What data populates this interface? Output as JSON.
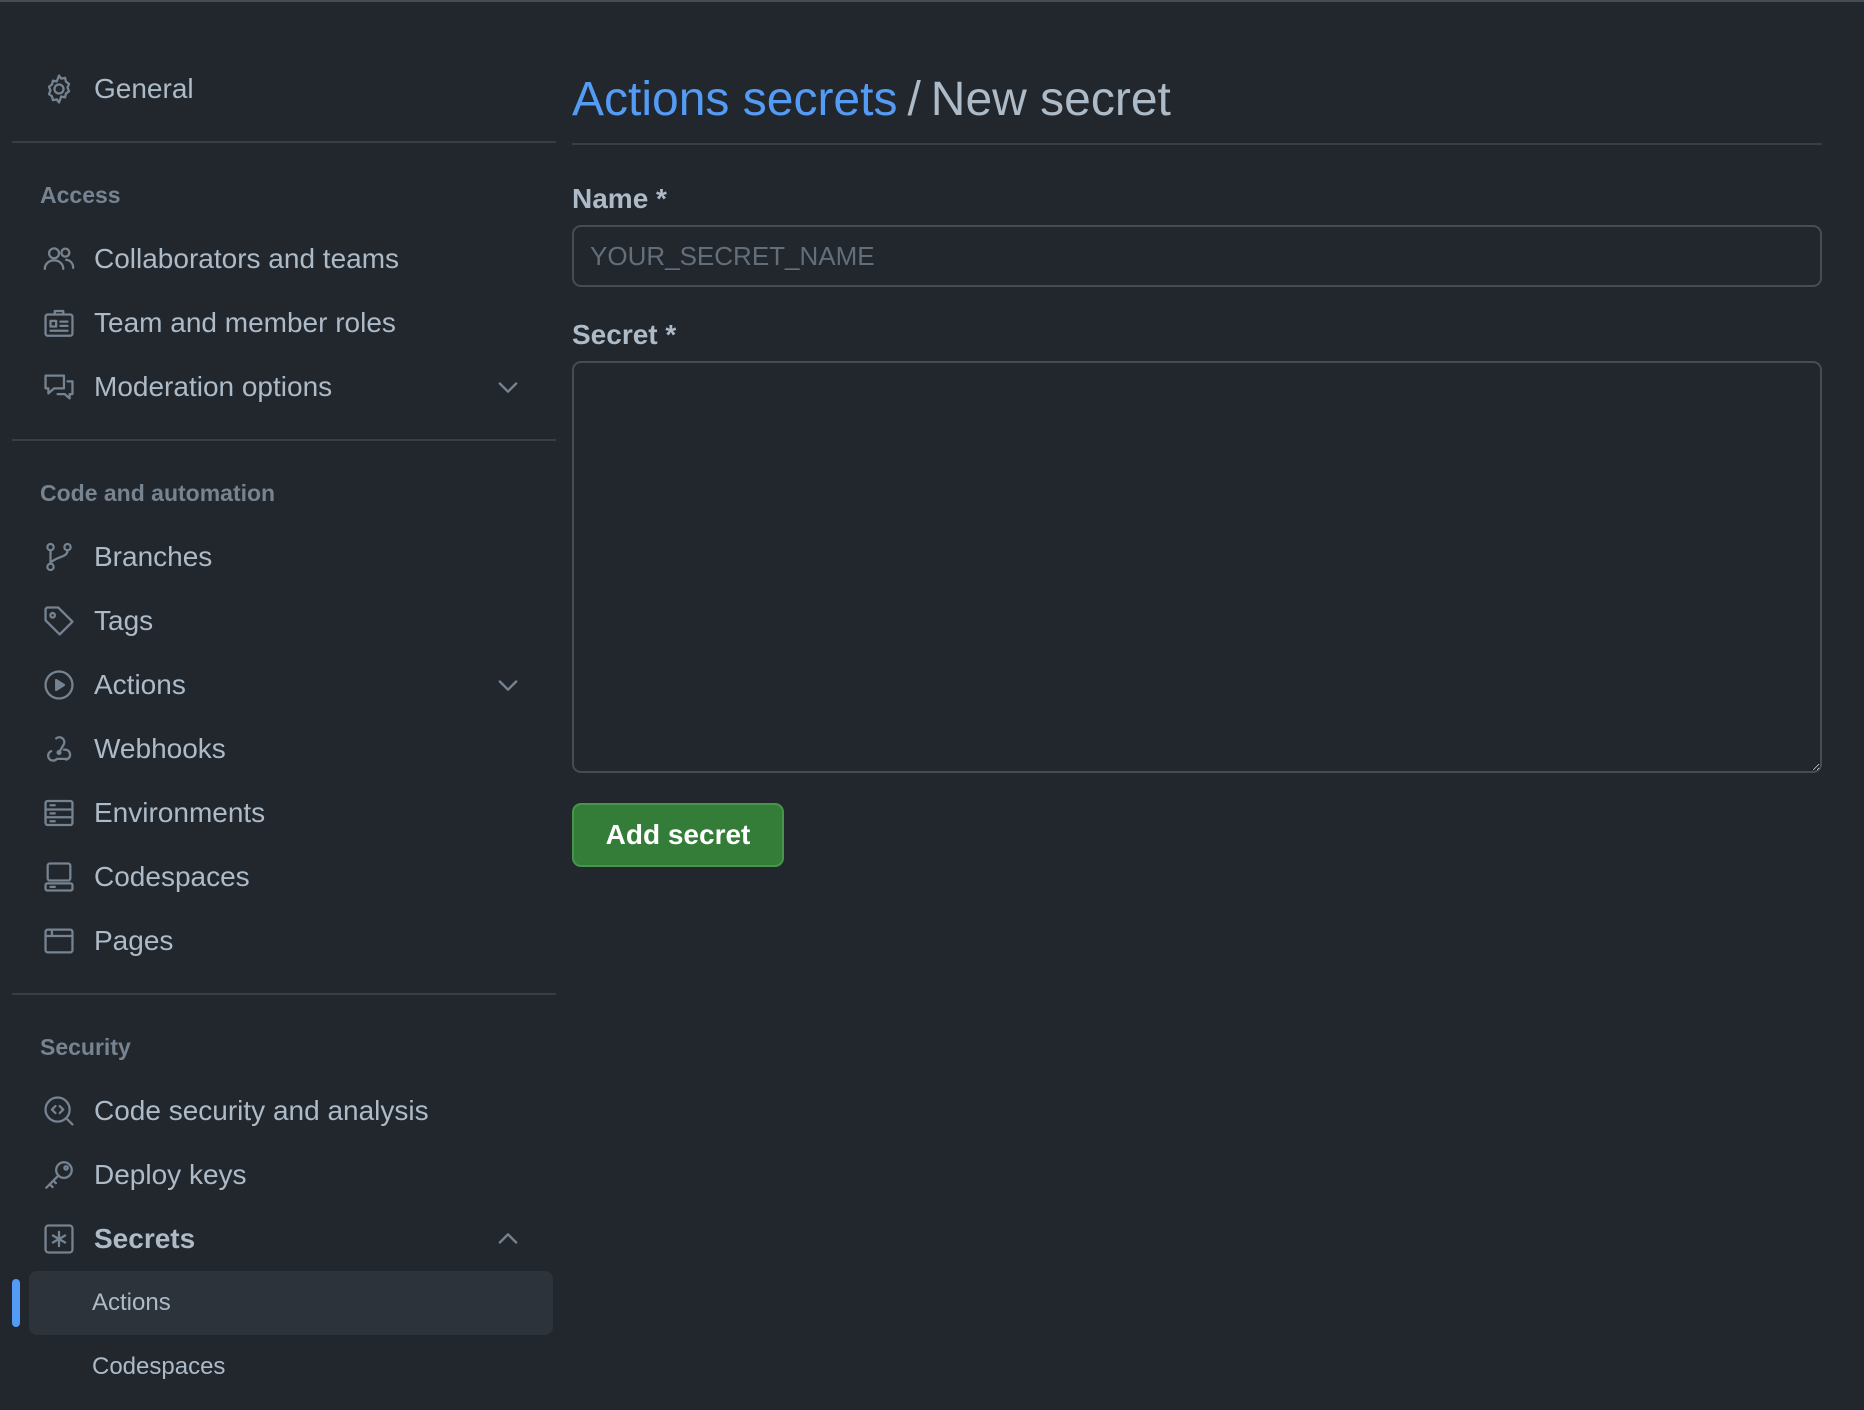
{
  "sidebar": {
    "general": {
      "label": "General",
      "icon": "gear-icon"
    },
    "sections": {
      "access": {
        "heading": "Access",
        "items": [
          {
            "label": "Collaborators and teams",
            "icon": "people-icon"
          },
          {
            "label": "Team and member roles",
            "icon": "id-badge-icon"
          },
          {
            "label": "Moderation options",
            "icon": "comment-discussion-icon",
            "expandable": true,
            "expanded": false
          }
        ]
      },
      "code_automation": {
        "heading": "Code and automation",
        "items": [
          {
            "label": "Branches",
            "icon": "git-branch-icon"
          },
          {
            "label": "Tags",
            "icon": "tag-icon"
          },
          {
            "label": "Actions",
            "icon": "play-icon",
            "expandable": true,
            "expanded": false
          },
          {
            "label": "Webhooks",
            "icon": "webhook-icon"
          },
          {
            "label": "Environments",
            "icon": "server-icon"
          },
          {
            "label": "Codespaces",
            "icon": "codespaces-icon"
          },
          {
            "label": "Pages",
            "icon": "browser-icon"
          }
        ]
      },
      "security": {
        "heading": "Security",
        "items": [
          {
            "label": "Code security and analysis",
            "icon": "codescan-icon"
          },
          {
            "label": "Deploy keys",
            "icon": "key-icon"
          },
          {
            "label": "Secrets",
            "icon": "key-asterisk-icon",
            "expandable": true,
            "expanded": true
          }
        ],
        "secrets_subitems": [
          {
            "label": "Actions",
            "active": true
          },
          {
            "label": "Codespaces",
            "active": false
          }
        ]
      }
    }
  },
  "main": {
    "breadcrumb": {
      "parent": "Actions secrets",
      "separator": "/",
      "current": "New secret"
    },
    "name_field": {
      "label": "Name *",
      "placeholder": "YOUR_SECRET_NAME",
      "value": ""
    },
    "secret_field": {
      "label": "Secret *",
      "value": ""
    },
    "submit_label": "Add secret"
  },
  "colors": {
    "background": "#22272e",
    "link": "#539bf5",
    "primary_button": "#347d39",
    "active_indicator": "#539bf5",
    "border": "#444c56"
  }
}
